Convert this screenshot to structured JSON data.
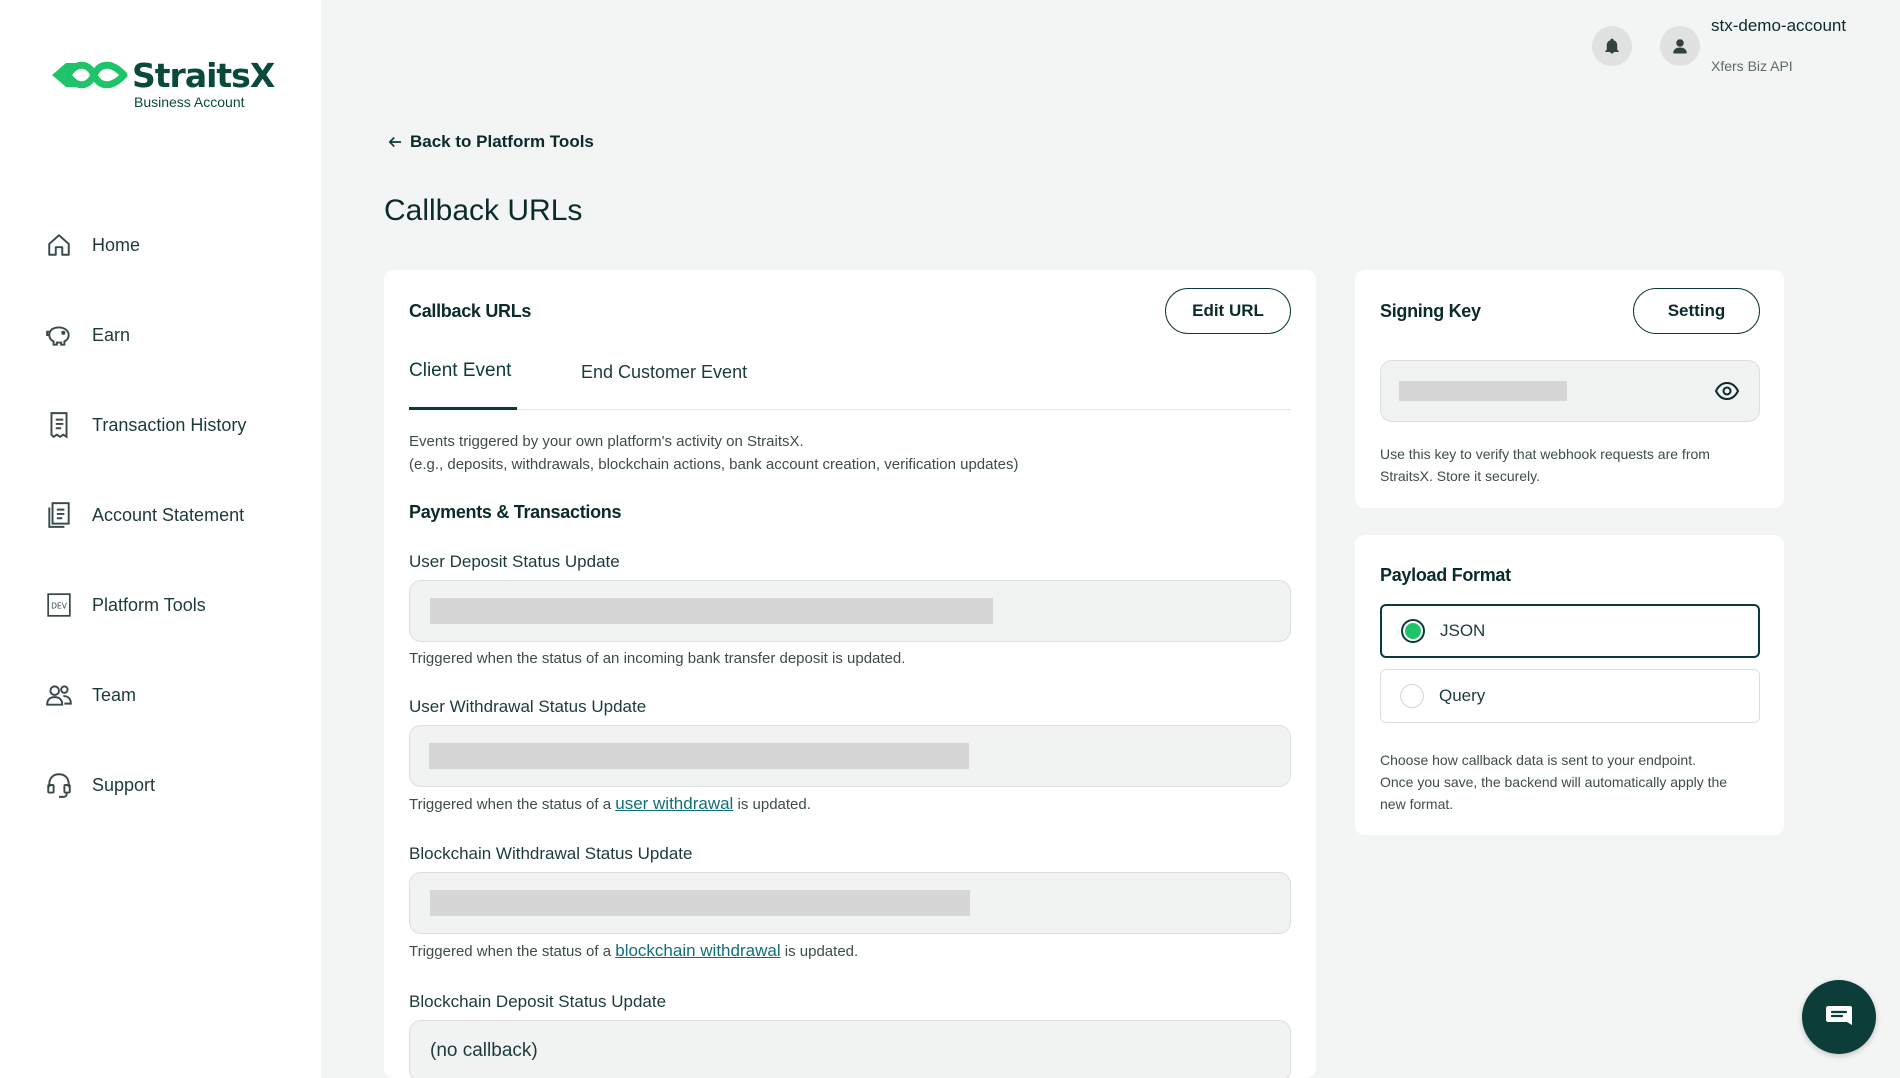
{
  "brand": {
    "name": "StraitsX",
    "subtitle": "Business Account",
    "color": "#0a4a3a",
    "accent": "#1fc46a"
  },
  "sidebar": {
    "items": [
      {
        "label": "Home",
        "icon": "home-icon"
      },
      {
        "label": "Earn",
        "icon": "piggy-bank-icon"
      },
      {
        "label": "Transaction History",
        "icon": "receipt-icon"
      },
      {
        "label": "Account Statement",
        "icon": "document-stack-icon"
      },
      {
        "label": "Platform Tools",
        "icon": "dev-icon"
      },
      {
        "label": "Team",
        "icon": "team-icon"
      },
      {
        "label": "Support",
        "icon": "headset-icon"
      }
    ]
  },
  "header": {
    "account_name": "stx-demo-account",
    "account_type": "Xfers Biz API",
    "back_label": "Back to Platform Tools",
    "page_title": "Callback URLs"
  },
  "main": {
    "card_title": "Callback URLs",
    "edit_button": "Edit URL",
    "tabs": [
      {
        "label": "Client Event",
        "active": true
      },
      {
        "label": "End Customer Event",
        "active": false
      }
    ],
    "description_line1": "Events triggered by your own platform's activity on StraitsX.",
    "description_line2": "(e.g., deposits, withdrawals, blockchain actions, bank account creation, verification updates)",
    "section_title": "Payments & Transactions",
    "fields": [
      {
        "label": "User Deposit Status Update",
        "value": "",
        "help_text": "Triggered when the status of an incoming bank transfer deposit is updated."
      },
      {
        "label": "User Withdrawal Status Update",
        "value": "",
        "help_prefix": "Triggered when the status of a",
        "help_link": "user withdrawal",
        "help_suffix": "is updated."
      },
      {
        "label": "Blockchain Withdrawal Status Update",
        "value": "",
        "help_prefix": "Triggered when the status of a",
        "help_link": "blockchain withdrawal",
        "help_suffix": "is updated."
      },
      {
        "label": "Blockchain Deposit Status Update",
        "value": "(no callback)"
      }
    ]
  },
  "signing_key": {
    "title": "Signing Key",
    "setting_button": "Setting",
    "help_line1": "Use this key to verify that webhook requests are from",
    "help_line2": "StraitsX. Store it securely."
  },
  "payload_format": {
    "title": "Payload Format",
    "options": [
      {
        "label": "JSON",
        "selected": true
      },
      {
        "label": "Query",
        "selected": false
      }
    ],
    "help_line1": "Choose how callback data is sent to your endpoint.",
    "help_line2": "Once you save, the backend will automatically apply the",
    "help_line3": "new format."
  },
  "chat": {
    "icon": "chat-bubble-icon"
  }
}
